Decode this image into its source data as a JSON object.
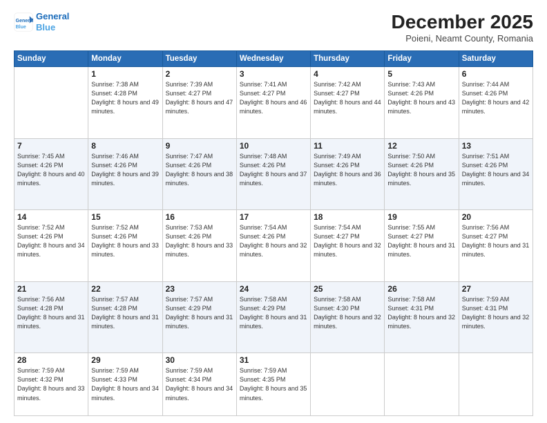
{
  "header": {
    "logo_line1": "General",
    "logo_line2": "Blue",
    "month": "December 2025",
    "location": "Poieni, Neamt County, Romania"
  },
  "days_of_week": [
    "Sunday",
    "Monday",
    "Tuesday",
    "Wednesday",
    "Thursday",
    "Friday",
    "Saturday"
  ],
  "weeks": [
    [
      {
        "day": null
      },
      {
        "day": "1",
        "sunrise": "7:38 AM",
        "sunset": "4:28 PM",
        "daylight": "8 hours and 49 minutes."
      },
      {
        "day": "2",
        "sunrise": "7:39 AM",
        "sunset": "4:27 PM",
        "daylight": "8 hours and 47 minutes."
      },
      {
        "day": "3",
        "sunrise": "7:41 AM",
        "sunset": "4:27 PM",
        "daylight": "8 hours and 46 minutes."
      },
      {
        "day": "4",
        "sunrise": "7:42 AM",
        "sunset": "4:27 PM",
        "daylight": "8 hours and 44 minutes."
      },
      {
        "day": "5",
        "sunrise": "7:43 AM",
        "sunset": "4:26 PM",
        "daylight": "8 hours and 43 minutes."
      },
      {
        "day": "6",
        "sunrise": "7:44 AM",
        "sunset": "4:26 PM",
        "daylight": "8 hours and 42 minutes."
      }
    ],
    [
      {
        "day": "7",
        "sunrise": "7:45 AM",
        "sunset": "4:26 PM",
        "daylight": "8 hours and 40 minutes."
      },
      {
        "day": "8",
        "sunrise": "7:46 AM",
        "sunset": "4:26 PM",
        "daylight": "8 hours and 39 minutes."
      },
      {
        "day": "9",
        "sunrise": "7:47 AM",
        "sunset": "4:26 PM",
        "daylight": "8 hours and 38 minutes."
      },
      {
        "day": "10",
        "sunrise": "7:48 AM",
        "sunset": "4:26 PM",
        "daylight": "8 hours and 37 minutes."
      },
      {
        "day": "11",
        "sunrise": "7:49 AM",
        "sunset": "4:26 PM",
        "daylight": "8 hours and 36 minutes."
      },
      {
        "day": "12",
        "sunrise": "7:50 AM",
        "sunset": "4:26 PM",
        "daylight": "8 hours and 35 minutes."
      },
      {
        "day": "13",
        "sunrise": "7:51 AM",
        "sunset": "4:26 PM",
        "daylight": "8 hours and 34 minutes."
      }
    ],
    [
      {
        "day": "14",
        "sunrise": "7:52 AM",
        "sunset": "4:26 PM",
        "daylight": "8 hours and 34 minutes."
      },
      {
        "day": "15",
        "sunrise": "7:52 AM",
        "sunset": "4:26 PM",
        "daylight": "8 hours and 33 minutes."
      },
      {
        "day": "16",
        "sunrise": "7:53 AM",
        "sunset": "4:26 PM",
        "daylight": "8 hours and 33 minutes."
      },
      {
        "day": "17",
        "sunrise": "7:54 AM",
        "sunset": "4:26 PM",
        "daylight": "8 hours and 32 minutes."
      },
      {
        "day": "18",
        "sunrise": "7:54 AM",
        "sunset": "4:27 PM",
        "daylight": "8 hours and 32 minutes."
      },
      {
        "day": "19",
        "sunrise": "7:55 AM",
        "sunset": "4:27 PM",
        "daylight": "8 hours and 31 minutes."
      },
      {
        "day": "20",
        "sunrise": "7:56 AM",
        "sunset": "4:27 PM",
        "daylight": "8 hours and 31 minutes."
      }
    ],
    [
      {
        "day": "21",
        "sunrise": "7:56 AM",
        "sunset": "4:28 PM",
        "daylight": "8 hours and 31 minutes."
      },
      {
        "day": "22",
        "sunrise": "7:57 AM",
        "sunset": "4:28 PM",
        "daylight": "8 hours and 31 minutes."
      },
      {
        "day": "23",
        "sunrise": "7:57 AM",
        "sunset": "4:29 PM",
        "daylight": "8 hours and 31 minutes."
      },
      {
        "day": "24",
        "sunrise": "7:58 AM",
        "sunset": "4:29 PM",
        "daylight": "8 hours and 31 minutes."
      },
      {
        "day": "25",
        "sunrise": "7:58 AM",
        "sunset": "4:30 PM",
        "daylight": "8 hours and 32 minutes."
      },
      {
        "day": "26",
        "sunrise": "7:58 AM",
        "sunset": "4:31 PM",
        "daylight": "8 hours and 32 minutes."
      },
      {
        "day": "27",
        "sunrise": "7:59 AM",
        "sunset": "4:31 PM",
        "daylight": "8 hours and 32 minutes."
      }
    ],
    [
      {
        "day": "28",
        "sunrise": "7:59 AM",
        "sunset": "4:32 PM",
        "daylight": "8 hours and 33 minutes."
      },
      {
        "day": "29",
        "sunrise": "7:59 AM",
        "sunset": "4:33 PM",
        "daylight": "8 hours and 34 minutes."
      },
      {
        "day": "30",
        "sunrise": "7:59 AM",
        "sunset": "4:34 PM",
        "daylight": "8 hours and 34 minutes."
      },
      {
        "day": "31",
        "sunrise": "7:59 AM",
        "sunset": "4:35 PM",
        "daylight": "8 hours and 35 minutes."
      },
      {
        "day": null
      },
      {
        "day": null
      },
      {
        "day": null
      }
    ]
  ]
}
